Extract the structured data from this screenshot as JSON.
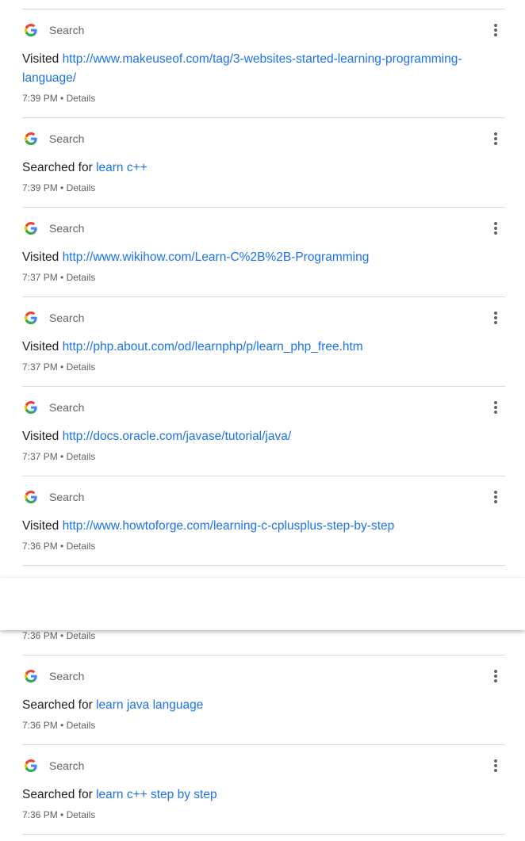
{
  "colors": {
    "link": "#1a73e8",
    "text": "#202124",
    "muted": "#5f6368",
    "divider": "#dadce0"
  },
  "icons": {
    "product": "google-g-icon",
    "menu": "more-vert-icon"
  },
  "entries": [
    {
      "product": "Search",
      "action": "Visited",
      "target": "http://www.makeuseof.com/tag/3-websites-started-learning-programming-language/",
      "time": "7:39 PM",
      "bullet": "•",
      "details": "Details"
    },
    {
      "product": "Search",
      "action": "Searched for",
      "target": "learn c++",
      "time": "7:39 PM",
      "bullet": "•",
      "details": "Details"
    },
    {
      "product": "Search",
      "action": "Visited",
      "target": "http://www.wikihow.com/Learn-C%2B%2B-Programming",
      "time": "7:37 PM",
      "bullet": "•",
      "details": "Details"
    },
    {
      "product": "Search",
      "action": "Visited",
      "target": "http://php.about.com/od/learnphp/p/learn_php_free.htm",
      "time": "7:37 PM",
      "bullet": "•",
      "details": "Details"
    },
    {
      "product": "Search",
      "action": "Visited",
      "target": "http://docs.oracle.com/javase/tutorial/java/",
      "time": "7:37 PM",
      "bullet": "•",
      "details": "Details"
    },
    {
      "product": "Search",
      "action": "Visited",
      "target": "http://www.howtoforge.com/learning-c-cplusplus-step-by-step",
      "time": "7:36 PM",
      "bullet": "•",
      "details": "Details"
    },
    {
      "time": "7:36 PM",
      "bullet": "•",
      "details": "Details",
      "partial": true
    },
    {
      "product": "Search",
      "action": "Searched for",
      "target": "learn java language",
      "time": "7:36 PM",
      "bullet": "•",
      "details": "Details"
    },
    {
      "product": "Search",
      "action": "Searched for",
      "target": "learn c++ step by step",
      "time": "7:36 PM",
      "bullet": "•",
      "details": "Details"
    }
  ]
}
